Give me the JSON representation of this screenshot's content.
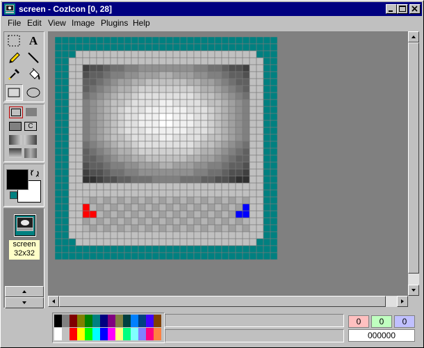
{
  "window": {
    "title": "screen - CozIcon [0, 28]"
  },
  "menu": {
    "file": "File",
    "edit": "Edit",
    "view": "View",
    "image": "Image",
    "plugins": "Plugins",
    "help": "Help"
  },
  "tools": {
    "text_glyph": "A",
    "fill_c": "C"
  },
  "icon_list": {
    "name": "screen",
    "size": "32x32"
  },
  "status": {
    "r": "0",
    "g": "0",
    "b": "0",
    "hex": "000000"
  },
  "colors": {
    "accent": "#008080",
    "titlebar": "#000080",
    "foreground": "#000000",
    "background": "#ffffff"
  },
  "palette_top": [
    "#000000",
    "#808080",
    "#800000",
    "#808000",
    "#008000",
    "#008080",
    "#000080",
    "#800080",
    "#808040",
    "#004040",
    "#0080ff",
    "#004080",
    "#4000ff",
    "#804000"
  ],
  "palette_bottom": [
    "#ffffff",
    "#c0c0c0",
    "#ff0000",
    "#ffff00",
    "#00ff00",
    "#00ffff",
    "#0000ff",
    "#ff00ff",
    "#ffff80",
    "#00ff80",
    "#80ffff",
    "#8080ff",
    "#ff0080",
    "#ff8040"
  ]
}
